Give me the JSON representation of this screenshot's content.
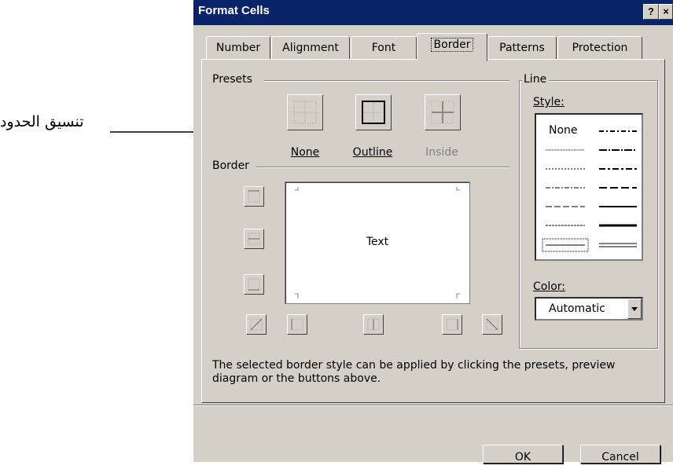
{
  "annotation": {
    "text": "تنسيق الحدود"
  },
  "window": {
    "title": "Format Cells",
    "help_glyph": "?",
    "close_glyph": "×"
  },
  "tabs": [
    {
      "label": "Number"
    },
    {
      "label": "Alignment"
    },
    {
      "label": "Font"
    },
    {
      "label": "Border",
      "active": true
    },
    {
      "label": "Patterns"
    },
    {
      "label": "Protection"
    }
  ],
  "presets": {
    "label": "Presets",
    "items": [
      {
        "label": "None",
        "enabled": true
      },
      {
        "label": "Outline",
        "enabled": true
      },
      {
        "label": "Inside",
        "enabled": false
      }
    ]
  },
  "border": {
    "label": "Border",
    "preview_text": "Text"
  },
  "line": {
    "label": "Line",
    "style_label": "Style:",
    "style_none": "None",
    "color_label": "Color:",
    "color_value": "Automatic"
  },
  "help_text": "The selected border style can be applied by clicking the presets, preview diagram or the buttons above.",
  "buttons": {
    "ok": "OK",
    "cancel": "Cancel"
  },
  "colors": {
    "dialog_bg": "#d4d0c8",
    "titlebar": "#0a246a"
  }
}
